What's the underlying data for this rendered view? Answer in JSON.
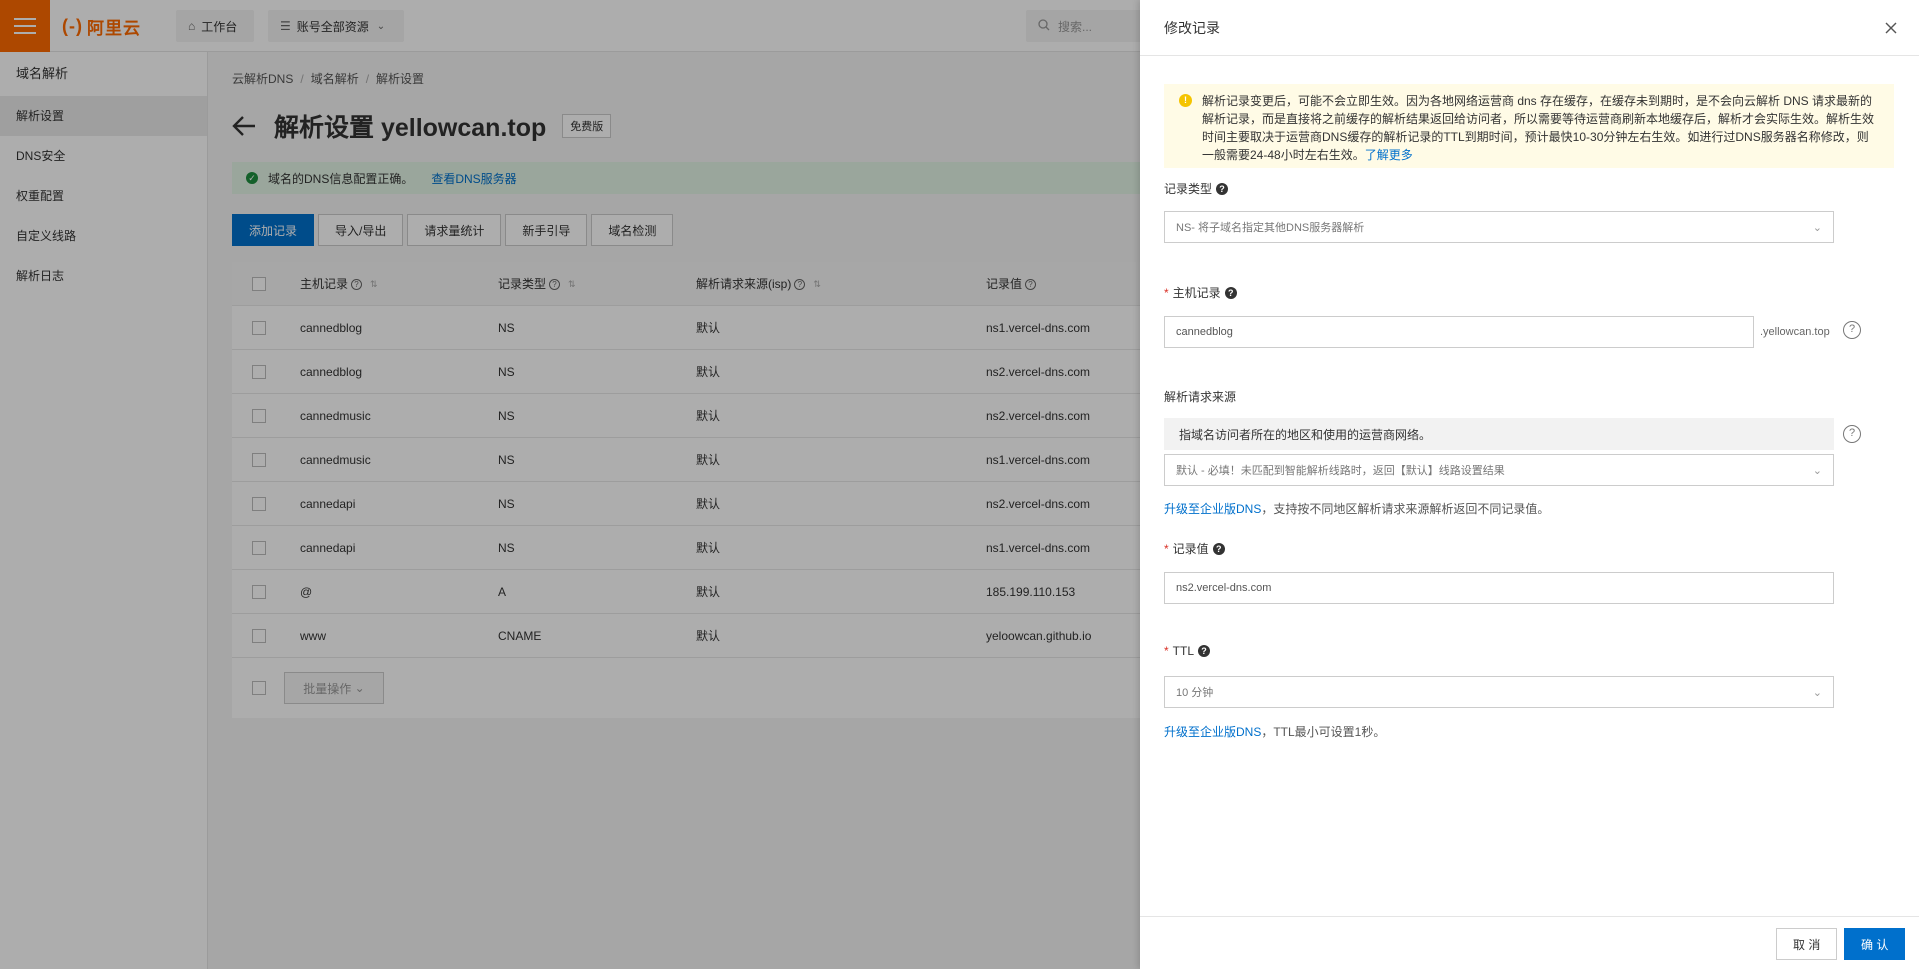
{
  "topbar": {
    "logo": "阿里云",
    "workbench": "工作台",
    "resources": "账号全部资源",
    "search_placeholder": "搜索..."
  },
  "sidebar": {
    "title": "域名解析",
    "items": [
      {
        "label": "解析设置",
        "active": true
      },
      {
        "label": "DNS安全"
      },
      {
        "label": "权重配置"
      },
      {
        "label": "自定义线路"
      },
      {
        "label": "解析日志"
      }
    ]
  },
  "breadcrumb": [
    "云解析DNS",
    "域名解析",
    "解析设置"
  ],
  "page": {
    "title": "解析设置 yellowcan.top",
    "badge": "免费版",
    "status_text": "域名的DNS信息配置正确。",
    "status_link": "查看DNS服务器"
  },
  "toolbar": {
    "add": "添加记录",
    "import_export": "导入/导出",
    "stats": "请求量统计",
    "guide": "新手引导",
    "check": "域名检测"
  },
  "table": {
    "headers": {
      "host": "主机记录",
      "type": "记录类型",
      "isp": "解析请求来源(isp)",
      "value": "记录值"
    },
    "rows": [
      {
        "host": "cannedblog",
        "type": "NS",
        "isp": "默认",
        "value": "ns1.vercel-dns.com"
      },
      {
        "host": "cannedblog",
        "type": "NS",
        "isp": "默认",
        "value": "ns2.vercel-dns.com"
      },
      {
        "host": "cannedmusic",
        "type": "NS",
        "isp": "默认",
        "value": "ns2.vercel-dns.com"
      },
      {
        "host": "cannedmusic",
        "type": "NS",
        "isp": "默认",
        "value": "ns1.vercel-dns.com"
      },
      {
        "host": "cannedapi",
        "type": "NS",
        "isp": "默认",
        "value": "ns2.vercel-dns.com"
      },
      {
        "host": "cannedapi",
        "type": "NS",
        "isp": "默认",
        "value": "ns1.vercel-dns.com"
      },
      {
        "host": "@",
        "type": "A",
        "isp": "默认",
        "value": "185.199.110.153"
      },
      {
        "host": "www",
        "type": "CNAME",
        "isp": "默认",
        "value": "yeloowcan.github.io"
      }
    ],
    "batch_label": "批量操作"
  },
  "drawer": {
    "title": "修改记录",
    "warning": "解析记录变更后，可能不会立即生效。因为各地网络运营商 dns 存在缓存，在缓存未到期时，是不会向云解析 DNS 请求最新的解析记录，而是直接将之前缓存的解析结果返回给访问者，所以需要等待运营商刷新本地缓存后，解析才会实际生效。解析生效时间主要取决于运营商DNS缓存的解析记录的TTL到期时间，预计最快10-30分钟左右生效。如进行过DNS服务器名称修改，则一般需要24-48小时左右生效。",
    "warning_link": "了解更多",
    "record_type_label": "记录类型",
    "record_type_value": "NS- 将子域名指定其他DNS服务器解析",
    "host_label": "主机记录",
    "host_value": "cannedblog",
    "host_suffix": ".yellowcan.top",
    "isp_label": "解析请求来源",
    "isp_hint": "指域名访问者所在的地区和使用的运营商网络。",
    "isp_value": "默认 - 必填！未匹配到智能解析线路时，返回【默认】线路设置结果",
    "isp_note_link": "升级至企业版DNS",
    "isp_note_text": "，支持按不同地区解析请求来源解析返回不同记录值。",
    "value_label": "记录值",
    "value_value": "ns2.vercel-dns.com",
    "ttl_label": "TTL",
    "ttl_value": "10 分钟",
    "ttl_note_link": "升级至企业版DNS",
    "ttl_note_text": "，TTL最小可设置1秒。",
    "cancel": "取 消",
    "confirm": "确 认"
  }
}
